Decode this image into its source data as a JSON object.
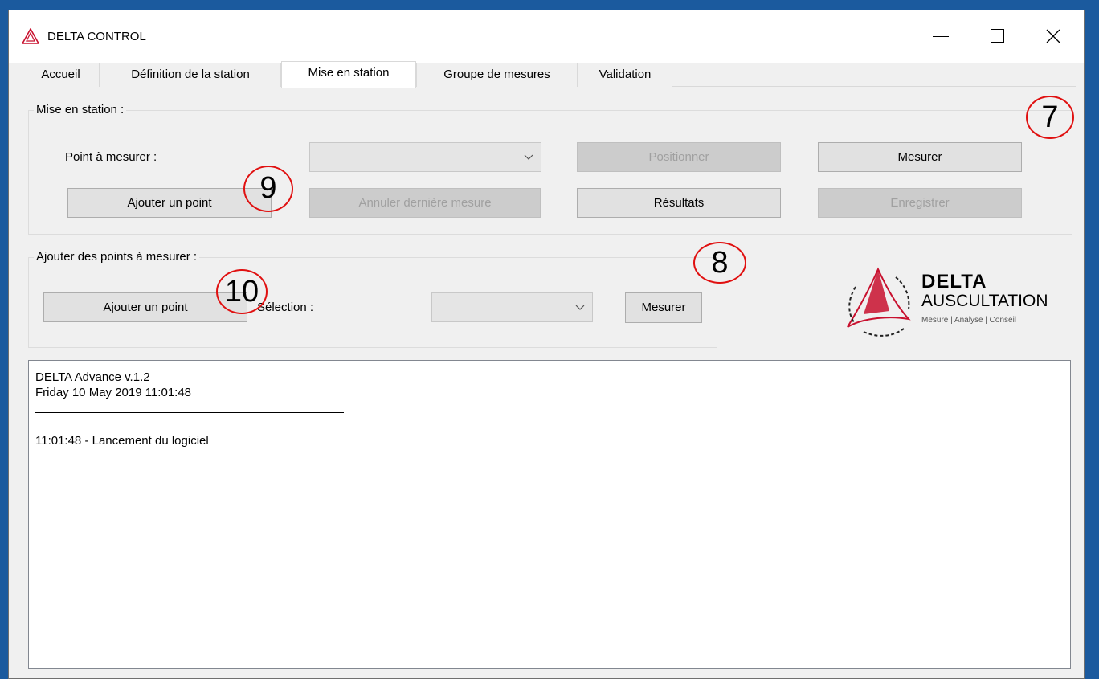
{
  "window": {
    "title": "DELTA CONTROL",
    "controls": {
      "minimize": "minimize-icon",
      "maximize": "maximize-icon",
      "close": "close-icon"
    }
  },
  "tabs": [
    {
      "label": "Accueil",
      "active": false
    },
    {
      "label": "Définition de la station",
      "active": false
    },
    {
      "label": "Mise en station",
      "active": true
    },
    {
      "label": "Groupe de mesures",
      "active": false
    },
    {
      "label": "Validation",
      "active": false
    }
  ],
  "mise_en_station": {
    "legend": "Mise en station :",
    "point_label": "Point à mesurer :",
    "point_select_value": "",
    "positionner": "Positionner",
    "mesurer": "Mesurer",
    "ajouter_point": "Ajouter un point",
    "annuler": "Annuler dernière mesure",
    "resultats": "Résultats",
    "enregistrer": "Enregistrer"
  },
  "ajouter_points": {
    "legend": "Ajouter des points à mesurer :",
    "ajouter_point": "Ajouter un point",
    "selection_label": "Sélection :",
    "selection_value": "",
    "mesurer": "Mesurer"
  },
  "annotations": [
    "7",
    "8",
    "9",
    "10"
  ],
  "logo": {
    "title": "DELTA",
    "subtitle": "AUSCULTATION",
    "tagline": "Mesure | Analyse | Conseil"
  },
  "log": {
    "header_line1": "DELTA Advance v.1.2",
    "header_line2": "Friday 10 May 2019 11:01:48",
    "entries": [
      "11:01:48  -  Lancement du logiciel"
    ]
  },
  "colors": {
    "accent_red": "#e01010",
    "logo_red": "#c8102e",
    "desktop_blue": "#1b5a9e"
  }
}
